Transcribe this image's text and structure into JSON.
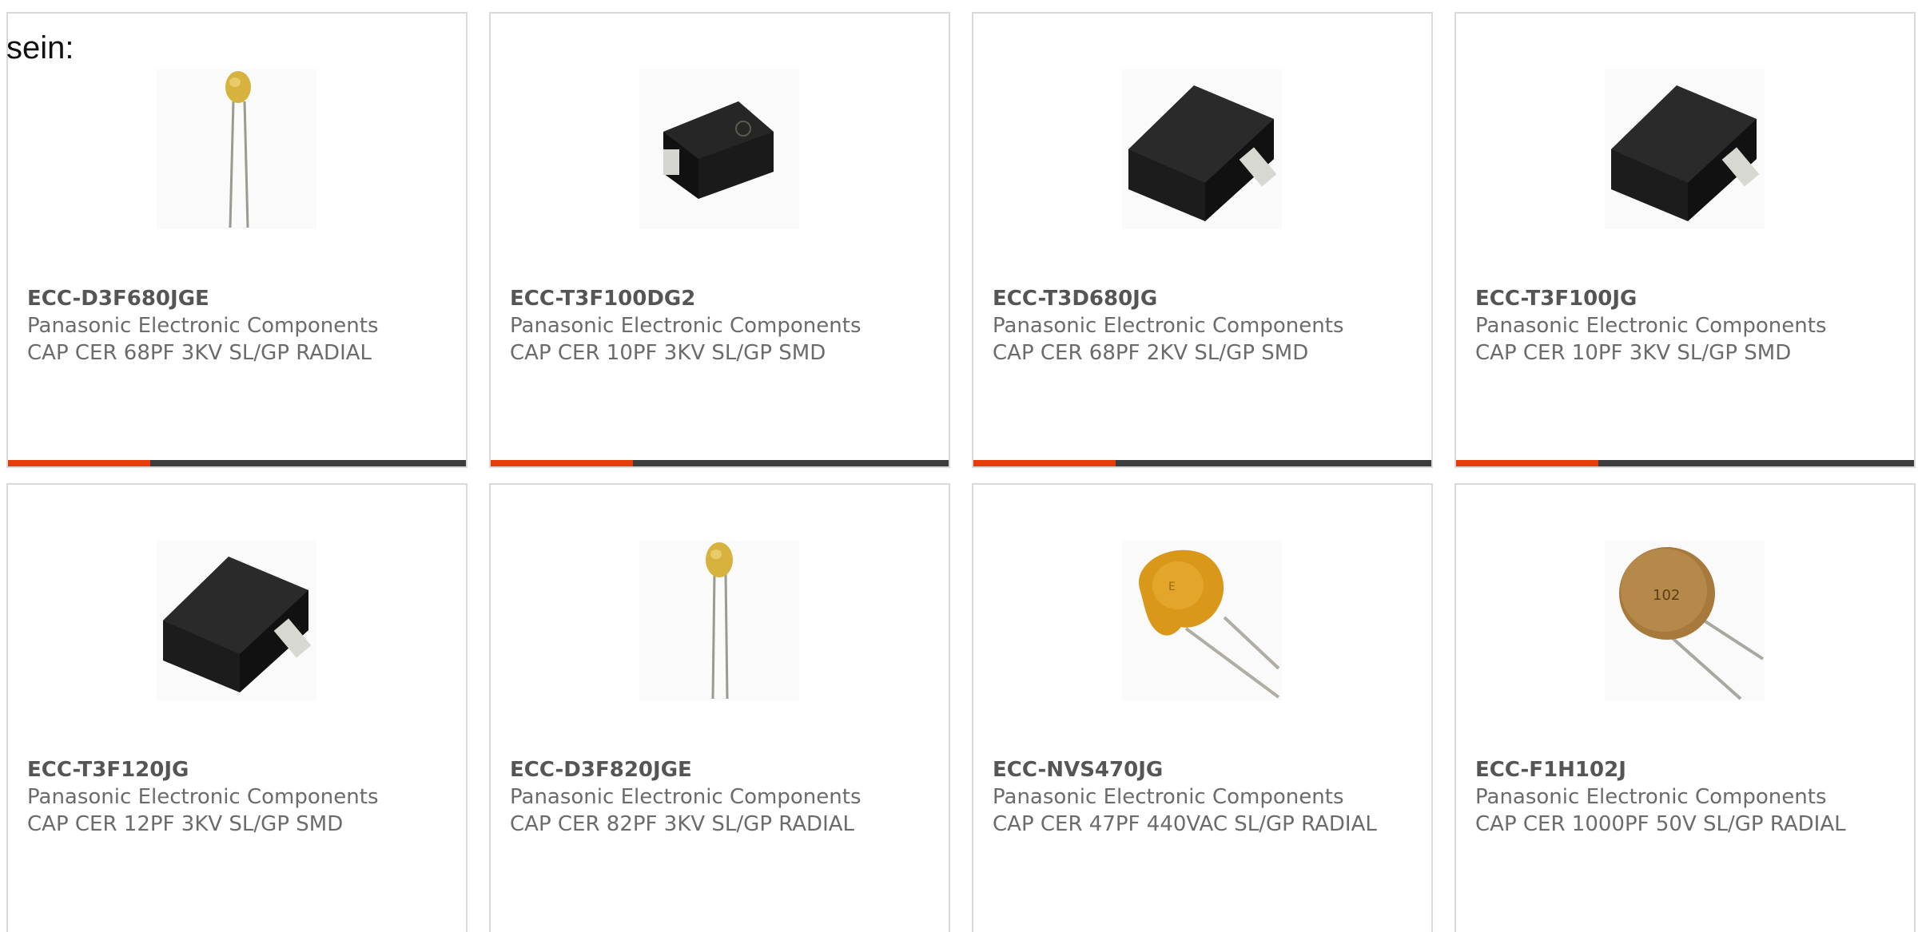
{
  "lead_text": "sein:",
  "colors": {
    "accent": "#e63c0a",
    "track": "#3d3d3d",
    "border": "#d9d9d9",
    "text": "#6b6b6b"
  },
  "cards": [
    {
      "part_number": "ECC-D3F680JGE",
      "manufacturer": "Panasonic Electronic Components",
      "description": "CAP CER 68PF 3KV SL/GP RADIAL",
      "image_icon": "radial-disc-capacitor-icon",
      "progress": 0.31
    },
    {
      "part_number": "ECC-T3F100DG2",
      "manufacturer": "Panasonic Electronic Components",
      "description": "CAP CER 10PF 3KV SL/GP SMD",
      "image_icon": "smd-capacitor-icon",
      "progress": 0.31
    },
    {
      "part_number": "ECC-T3D680JG",
      "manufacturer": "Panasonic Electronic Components",
      "description": "CAP CER 68PF 2KV SL/GP SMD",
      "image_icon": "smd-capacitor-icon",
      "progress": 0.31
    },
    {
      "part_number": "ECC-T3F100JG",
      "manufacturer": "Panasonic Electronic Components",
      "description": "CAP CER 10PF 3KV SL/GP SMD",
      "image_icon": "smd-capacitor-icon",
      "progress": 0.31
    },
    {
      "part_number": "ECC-T3F120JG",
      "manufacturer": "Panasonic Electronic Components",
      "description": "CAP CER 12PF 3KV SL/GP SMD",
      "image_icon": "smd-capacitor-icon"
    },
    {
      "part_number": "ECC-D3F820JGE",
      "manufacturer": "Panasonic Electronic Components",
      "description": "CAP CER 82PF 3KV SL/GP RADIAL",
      "image_icon": "radial-disc-capacitor-icon"
    },
    {
      "part_number": "ECC-NVS470JG",
      "manufacturer": "Panasonic Electronic Components",
      "description": "CAP CER 47PF 440VAC SL/GP RADIAL",
      "image_icon": "orange-disc-capacitor-icon"
    },
    {
      "part_number": "ECC-F1H102J",
      "manufacturer": "Panasonic Electronic Components",
      "description": "CAP CER 1000PF 50V SL/GP RADIAL",
      "image_icon": "brown-disc-capacitor-icon"
    }
  ]
}
